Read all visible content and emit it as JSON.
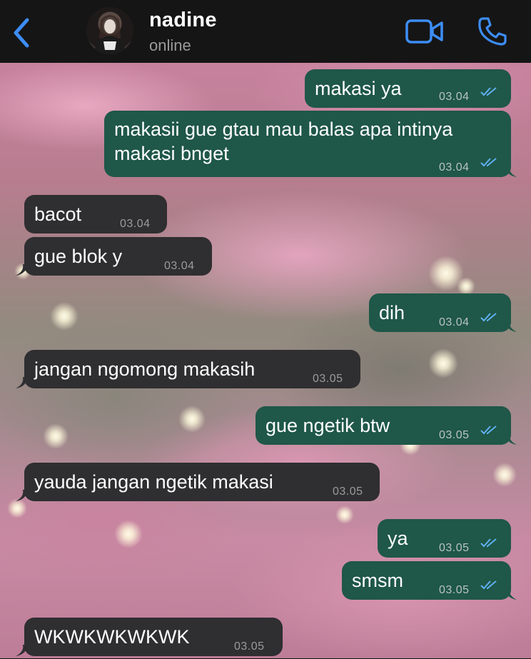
{
  "header": {
    "contact_name": "nadine",
    "status": "online",
    "back_icon": "chevron-left-icon",
    "video_icon": "video-camera-icon",
    "call_icon": "phone-icon"
  },
  "colors": {
    "accent": "#3d8df5",
    "outgoing_bubble": "#1f5748",
    "incoming_bubble": "#2f2e30",
    "read_ticks": "#5fb0f2"
  },
  "messages": [
    {
      "direction": "out",
      "text": "makasi ya",
      "time": "03.04",
      "read": true
    },
    {
      "direction": "out",
      "text": "makasii gue gtau mau balas apa intinya\nmakasi bnget",
      "time": "03.04",
      "read": true
    },
    {
      "direction": "in",
      "text": "bacot",
      "time": "03.04"
    },
    {
      "direction": "in",
      "text": "gue blok y",
      "time": "03.04"
    },
    {
      "direction": "out",
      "text": "dih",
      "time": "03.04",
      "read": true
    },
    {
      "direction": "in",
      "text": "jangan ngomong makasih",
      "time": "03.05"
    },
    {
      "direction": "out",
      "text": "gue ngetik btw",
      "time": "03.05",
      "read": true
    },
    {
      "direction": "in",
      "text": "yauda jangan ngetik makasi",
      "time": "03.05"
    },
    {
      "direction": "out",
      "text": "ya",
      "time": "03.05",
      "read": true
    },
    {
      "direction": "out",
      "text": "smsm",
      "time": "03.05",
      "read": true
    },
    {
      "direction": "in",
      "text": "WKWKWKWKWK",
      "time": "03.05"
    }
  ]
}
